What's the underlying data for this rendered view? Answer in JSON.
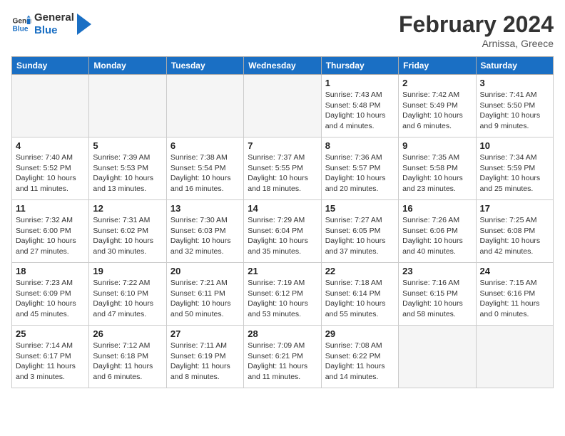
{
  "logo": {
    "line1": "General",
    "line2": "Blue"
  },
  "title": "February 2024",
  "location": "Arnissa, Greece",
  "weekdays": [
    "Sunday",
    "Monday",
    "Tuesday",
    "Wednesday",
    "Thursday",
    "Friday",
    "Saturday"
  ],
  "weeks": [
    [
      {
        "day": "",
        "info": ""
      },
      {
        "day": "",
        "info": ""
      },
      {
        "day": "",
        "info": ""
      },
      {
        "day": "",
        "info": ""
      },
      {
        "day": "1",
        "info": "Sunrise: 7:43 AM\nSunset: 5:48 PM\nDaylight: 10 hours\nand 4 minutes."
      },
      {
        "day": "2",
        "info": "Sunrise: 7:42 AM\nSunset: 5:49 PM\nDaylight: 10 hours\nand 6 minutes."
      },
      {
        "day": "3",
        "info": "Sunrise: 7:41 AM\nSunset: 5:50 PM\nDaylight: 10 hours\nand 9 minutes."
      }
    ],
    [
      {
        "day": "4",
        "info": "Sunrise: 7:40 AM\nSunset: 5:52 PM\nDaylight: 10 hours\nand 11 minutes."
      },
      {
        "day": "5",
        "info": "Sunrise: 7:39 AM\nSunset: 5:53 PM\nDaylight: 10 hours\nand 13 minutes."
      },
      {
        "day": "6",
        "info": "Sunrise: 7:38 AM\nSunset: 5:54 PM\nDaylight: 10 hours\nand 16 minutes."
      },
      {
        "day": "7",
        "info": "Sunrise: 7:37 AM\nSunset: 5:55 PM\nDaylight: 10 hours\nand 18 minutes."
      },
      {
        "day": "8",
        "info": "Sunrise: 7:36 AM\nSunset: 5:57 PM\nDaylight: 10 hours\nand 20 minutes."
      },
      {
        "day": "9",
        "info": "Sunrise: 7:35 AM\nSunset: 5:58 PM\nDaylight: 10 hours\nand 23 minutes."
      },
      {
        "day": "10",
        "info": "Sunrise: 7:34 AM\nSunset: 5:59 PM\nDaylight: 10 hours\nand 25 minutes."
      }
    ],
    [
      {
        "day": "11",
        "info": "Sunrise: 7:32 AM\nSunset: 6:00 PM\nDaylight: 10 hours\nand 27 minutes."
      },
      {
        "day": "12",
        "info": "Sunrise: 7:31 AM\nSunset: 6:02 PM\nDaylight: 10 hours\nand 30 minutes."
      },
      {
        "day": "13",
        "info": "Sunrise: 7:30 AM\nSunset: 6:03 PM\nDaylight: 10 hours\nand 32 minutes."
      },
      {
        "day": "14",
        "info": "Sunrise: 7:29 AM\nSunset: 6:04 PM\nDaylight: 10 hours\nand 35 minutes."
      },
      {
        "day": "15",
        "info": "Sunrise: 7:27 AM\nSunset: 6:05 PM\nDaylight: 10 hours\nand 37 minutes."
      },
      {
        "day": "16",
        "info": "Sunrise: 7:26 AM\nSunset: 6:06 PM\nDaylight: 10 hours\nand 40 minutes."
      },
      {
        "day": "17",
        "info": "Sunrise: 7:25 AM\nSunset: 6:08 PM\nDaylight: 10 hours\nand 42 minutes."
      }
    ],
    [
      {
        "day": "18",
        "info": "Sunrise: 7:23 AM\nSunset: 6:09 PM\nDaylight: 10 hours\nand 45 minutes."
      },
      {
        "day": "19",
        "info": "Sunrise: 7:22 AM\nSunset: 6:10 PM\nDaylight: 10 hours\nand 47 minutes."
      },
      {
        "day": "20",
        "info": "Sunrise: 7:21 AM\nSunset: 6:11 PM\nDaylight: 10 hours\nand 50 minutes."
      },
      {
        "day": "21",
        "info": "Sunrise: 7:19 AM\nSunset: 6:12 PM\nDaylight: 10 hours\nand 53 minutes."
      },
      {
        "day": "22",
        "info": "Sunrise: 7:18 AM\nSunset: 6:14 PM\nDaylight: 10 hours\nand 55 minutes."
      },
      {
        "day": "23",
        "info": "Sunrise: 7:16 AM\nSunset: 6:15 PM\nDaylight: 10 hours\nand 58 minutes."
      },
      {
        "day": "24",
        "info": "Sunrise: 7:15 AM\nSunset: 6:16 PM\nDaylight: 11 hours\nand 0 minutes."
      }
    ],
    [
      {
        "day": "25",
        "info": "Sunrise: 7:14 AM\nSunset: 6:17 PM\nDaylight: 11 hours\nand 3 minutes."
      },
      {
        "day": "26",
        "info": "Sunrise: 7:12 AM\nSunset: 6:18 PM\nDaylight: 11 hours\nand 6 minutes."
      },
      {
        "day": "27",
        "info": "Sunrise: 7:11 AM\nSunset: 6:19 PM\nDaylight: 11 hours\nand 8 minutes."
      },
      {
        "day": "28",
        "info": "Sunrise: 7:09 AM\nSunset: 6:21 PM\nDaylight: 11 hours\nand 11 minutes."
      },
      {
        "day": "29",
        "info": "Sunrise: 7:08 AM\nSunset: 6:22 PM\nDaylight: 11 hours\nand 14 minutes."
      },
      {
        "day": "",
        "info": ""
      },
      {
        "day": "",
        "info": ""
      }
    ]
  ]
}
